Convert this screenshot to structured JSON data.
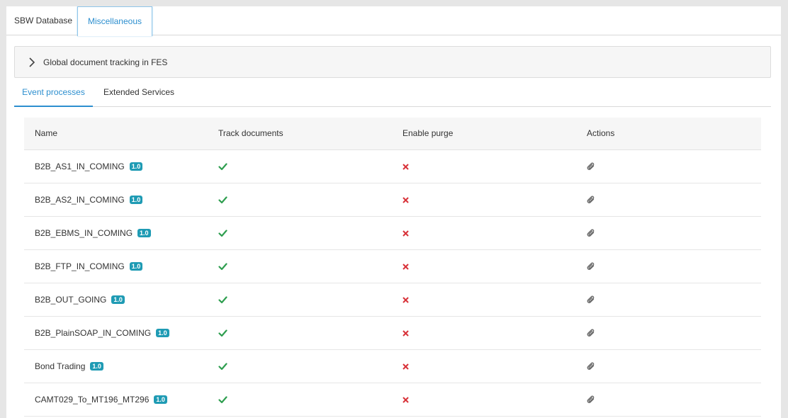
{
  "top_tabs": [
    {
      "label": "SBW Database"
    },
    {
      "label": "Miscellaneous"
    }
  ],
  "accordion": {
    "title": "Global document tracking in FES"
  },
  "sub_tabs": [
    {
      "label": "Event processes"
    },
    {
      "label": "Extended Services"
    }
  ],
  "table": {
    "headers": [
      "Name",
      "Track documents",
      "Enable purge",
      "Actions"
    ],
    "rows": [
      {
        "name": "B2B_AS1_IN_COMING",
        "version": "1.0"
      },
      {
        "name": "B2B_AS2_IN_COMING",
        "version": "1.0"
      },
      {
        "name": "B2B_EBMS_IN_COMING",
        "version": "1.0"
      },
      {
        "name": "B2B_FTP_IN_COMING",
        "version": "1.0"
      },
      {
        "name": "B2B_OUT_GOING",
        "version": "1.0"
      },
      {
        "name": "B2B_PlainSOAP_IN_COMING",
        "version": "1.0"
      },
      {
        "name": "Bond Trading",
        "version": "1.0"
      },
      {
        "name": "CAMT029_To_MT196_MT296",
        "version": "1.0"
      }
    ],
    "track_icon": "check-icon",
    "purge_icon": "cross-icon",
    "action_icon": "paperclip-icon"
  },
  "colors": {
    "accent": "#2d8fcf",
    "check": "#2e9e4f",
    "cross": "#d8333a",
    "badge": "#1f9bb4"
  }
}
